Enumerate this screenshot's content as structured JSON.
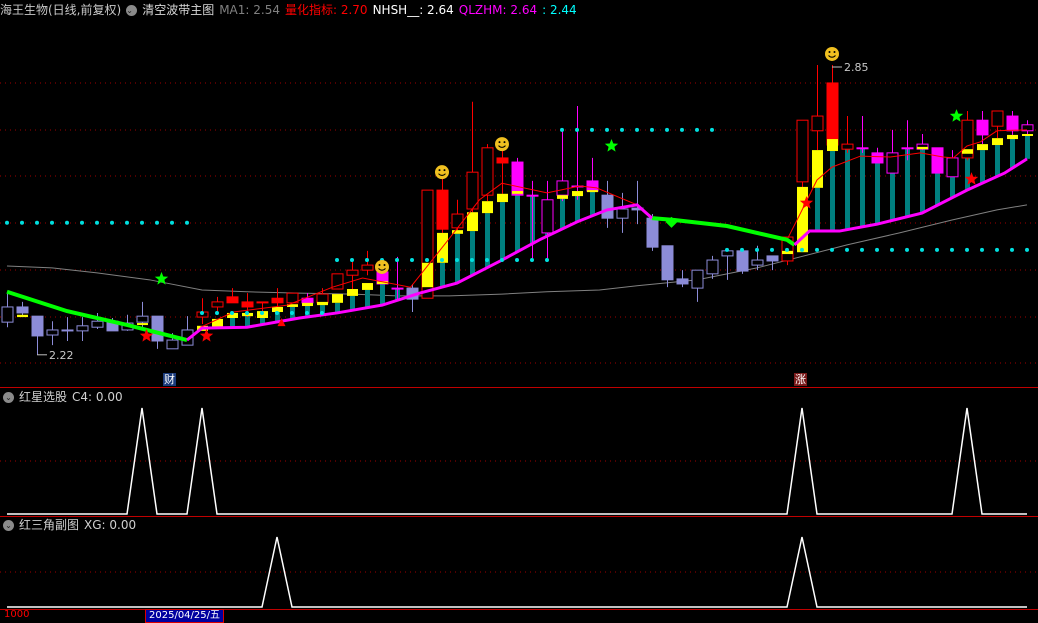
{
  "header": {
    "stock": "海王生物(日线,前复权)",
    "indicator": "清空波带主图",
    "ma1_label": "MA1: 2.54",
    "lh_label": "量化指标: 2.70",
    "nhsh_label": "NHSH__: 2.64",
    "qlzhm_label": "QLZHM: 2.64",
    "qlzhm_val2": ": 2.44"
  },
  "colors": {
    "up": "#ff0000",
    "weak": "#8c8cd8",
    "mag": "#ff00ff",
    "yellow": "#ffff00",
    "teal": "#008080",
    "green": "#00ff00",
    "cyan": "#00e0e0",
    "gray": "#808080",
    "grid": "#a00000"
  },
  "main": {
    "high_label": "2.85",
    "low_label": "2.22",
    "event_tag_1": "财",
    "event_tag_2": "涨",
    "price_range": [
      2.22,
      2.85
    ]
  },
  "chart_data": {
    "type": "candlestick",
    "candles": [
      [
        2.291,
        2.357,
        2.28,
        2.324,
        "L"
      ],
      [
        2.324,
        2.335,
        2.302,
        2.311,
        "L"
      ],
      [
        2.304,
        2.304,
        2.22,
        2.261,
        "L"
      ],
      [
        2.263,
        2.293,
        2.241,
        2.274,
        "L"
      ],
      [
        2.274,
        2.302,
        2.25,
        2.274,
        "L"
      ],
      [
        2.272,
        2.302,
        2.25,
        2.283,
        "L"
      ],
      [
        2.28,
        2.311,
        2.276,
        2.293,
        "L"
      ],
      [
        2.293,
        2.3,
        2.272,
        2.272,
        "L"
      ],
      [
        2.274,
        2.307,
        2.272,
        2.289,
        "L"
      ],
      [
        2.291,
        2.335,
        2.274,
        2.304,
        "L"
      ],
      [
        2.304,
        2.304,
        2.233,
        2.25,
        "L"
      ],
      [
        2.233,
        2.267,
        2.233,
        2.252,
        "L"
      ],
      [
        2.241,
        2.304,
        2.241,
        2.274,
        "L"
      ],
      [
        2.302,
        2.343,
        2.287,
        2.313,
        "R"
      ],
      [
        2.324,
        2.346,
        2.313,
        2.335,
        "R"
      ],
      [
        2.346,
        2.365,
        2.333,
        2.333,
        "R"
      ],
      [
        2.335,
        2.354,
        2.302,
        2.324,
        "R"
      ],
      [
        2.335,
        2.335,
        2.313,
        2.333,
        "R"
      ],
      [
        2.343,
        2.365,
        2.324,
        2.333,
        "R"
      ],
      [
        2.333,
        2.354,
        2.333,
        2.354,
        "R"
      ],
      [
        2.343,
        2.354,
        2.333,
        2.333,
        "M"
      ],
      [
        2.333,
        2.365,
        2.333,
        2.352,
        "R"
      ],
      [
        2.363,
        2.396,
        2.363,
        2.396,
        "R"
      ],
      [
        2.393,
        2.422,
        2.363,
        2.404,
        "R"
      ],
      [
        2.404,
        2.446,
        2.393,
        2.415,
        "R"
      ],
      [
        2.4,
        2.43,
        2.374,
        2.374,
        "M"
      ],
      [
        2.365,
        2.433,
        2.339,
        2.365,
        "M"
      ],
      [
        2.365,
        2.374,
        2.313,
        2.341,
        "L"
      ],
      [
        2.343,
        2.578,
        2.343,
        2.578,
        "R"
      ],
      [
        2.578,
        2.609,
        2.485,
        2.493,
        "R"
      ],
      [
        2.496,
        2.557,
        2.491,
        2.526,
        "R"
      ],
      [
        2.537,
        2.77,
        2.53,
        2.617,
        "R"
      ],
      [
        2.567,
        2.678,
        2.554,
        2.67,
        "R"
      ],
      [
        2.648,
        2.678,
        2.57,
        2.637,
        "R"
      ],
      [
        2.639,
        2.648,
        2.567,
        2.567,
        "M"
      ],
      [
        2.567,
        2.598,
        2.43,
        2.567,
        "M"
      ],
      [
        2.485,
        2.598,
        2.43,
        2.557,
        "M"
      ],
      [
        2.567,
        2.709,
        2.554,
        2.598,
        "M"
      ],
      [
        2.587,
        2.761,
        2.557,
        2.587,
        "M"
      ],
      [
        2.598,
        2.648,
        2.576,
        2.576,
        "M"
      ],
      [
        2.567,
        2.598,
        2.496,
        2.517,
        "L"
      ],
      [
        2.517,
        2.572,
        2.485,
        2.537,
        "L"
      ],
      [
        2.539,
        2.598,
        2.504,
        2.535,
        "L"
      ],
      [
        2.517,
        2.526,
        2.446,
        2.454,
        "L"
      ],
      [
        2.457,
        2.457,
        2.367,
        2.383,
        "L"
      ],
      [
        2.385,
        2.404,
        2.367,
        2.374,
        "L"
      ],
      [
        2.365,
        2.404,
        2.335,
        2.404,
        "L"
      ],
      [
        2.396,
        2.435,
        2.385,
        2.426,
        "L"
      ],
      [
        2.435,
        2.446,
        2.383,
        2.446,
        "L"
      ],
      [
        2.446,
        2.446,
        2.396,
        2.402,
        "L"
      ],
      [
        2.415,
        2.457,
        2.404,
        2.426,
        "L"
      ],
      [
        2.435,
        2.435,
        2.404,
        2.424,
        "L"
      ],
      [
        2.424,
        2.476,
        2.415,
        2.476,
        "R"
      ],
      [
        2.596,
        2.73,
        2.583,
        2.73,
        "R"
      ],
      [
        2.707,
        2.85,
        2.665,
        2.739,
        "R"
      ],
      [
        2.811,
        2.85,
        2.663,
        2.676,
        "R"
      ],
      [
        2.667,
        2.739,
        2.659,
        2.678,
        "R"
      ],
      [
        2.67,
        2.739,
        2.659,
        2.67,
        "M"
      ],
      [
        2.659,
        2.67,
        2.637,
        2.637,
        "M"
      ],
      [
        2.615,
        2.709,
        2.615,
        2.659,
        "M"
      ],
      [
        2.67,
        2.73,
        2.643,
        2.67,
        "M"
      ],
      [
        2.667,
        2.7,
        2.665,
        2.678,
        "M"
      ],
      [
        2.67,
        2.67,
        2.615,
        2.615,
        "M"
      ],
      [
        2.607,
        2.665,
        2.607,
        2.648,
        "M"
      ],
      [
        2.648,
        2.75,
        2.643,
        2.73,
        "R"
      ],
      [
        2.73,
        2.75,
        2.678,
        2.698,
        "M"
      ],
      [
        2.717,
        2.75,
        2.691,
        2.75,
        "R"
      ],
      [
        2.739,
        2.75,
        2.698,
        2.707,
        "M"
      ],
      [
        2.707,
        2.73,
        2.7,
        2.72,
        "M"
      ]
    ],
    "yellow_boxes": [
      [
        1,
        2.307,
        2.302
      ],
      [
        9,
        2.289,
        2.285
      ],
      [
        13,
        2.283,
        2.272
      ],
      [
        14,
        2.298,
        2.28
      ],
      [
        15,
        2.311,
        2.3
      ],
      [
        16,
        2.311,
        2.304
      ],
      [
        17,
        2.315,
        2.3
      ],
      [
        18,
        2.324,
        2.313
      ],
      [
        19,
        2.33,
        2.324
      ],
      [
        20,
        2.333,
        2.326
      ],
      [
        21,
        2.335,
        2.328
      ],
      [
        22,
        2.352,
        2.333
      ],
      [
        23,
        2.363,
        2.348
      ],
      [
        24,
        2.376,
        2.361
      ],
      [
        25,
        2.38,
        2.374
      ],
      [
        28,
        2.42,
        2.367
      ],
      [
        29,
        2.485,
        2.42
      ],
      [
        30,
        2.491,
        2.483
      ],
      [
        31,
        2.53,
        2.489
      ],
      [
        32,
        2.554,
        2.528
      ],
      [
        33,
        2.57,
        2.552
      ],
      [
        34,
        2.576,
        2.57
      ],
      [
        37,
        2.567,
        2.559
      ],
      [
        38,
        2.576,
        2.565
      ],
      [
        39,
        2.578,
        2.574
      ],
      [
        52,
        2.446,
        2.439
      ],
      [
        53,
        2.585,
        2.443
      ],
      [
        54,
        2.665,
        2.583
      ],
      [
        55,
        2.689,
        2.663
      ],
      [
        61,
        2.672,
        2.667
      ],
      [
        64,
        2.667,
        2.657
      ],
      [
        65,
        2.678,
        2.665
      ],
      [
        66,
        2.691,
        2.676
      ],
      [
        67,
        2.698,
        2.689
      ],
      [
        68,
        2.7,
        2.696
      ]
    ],
    "teal_ranges": [
      [
        14,
        39
      ],
      [
        54,
        68
      ]
    ],
    "lines": {
      "support_weak_1": [
        [
          0,
          2.357
        ],
        [
          4,
          2.315
        ],
        [
          8,
          2.285
        ],
        [
          12,
          2.252
        ]
      ],
      "support_1": [
        [
          12,
          2.252
        ],
        [
          13,
          2.278
        ],
        [
          16,
          2.28
        ],
        [
          19.5,
          2.3
        ],
        [
          22,
          2.311
        ],
        [
          25,
          2.328
        ],
        [
          27.5,
          2.354
        ],
        [
          30,
          2.376
        ],
        [
          33,
          2.426
        ],
        [
          35.5,
          2.47
        ],
        [
          38,
          2.509
        ],
        [
          40,
          2.535
        ],
        [
          42,
          2.546
        ],
        [
          43,
          2.517
        ]
      ],
      "support_weak_2": [
        [
          43,
          2.517
        ],
        [
          44.5,
          2.513
        ],
        [
          48,
          2.5
        ],
        [
          52,
          2.47
        ],
        [
          52.5,
          2.459
        ]
      ],
      "support_2": [
        [
          52.5,
          2.459
        ],
        [
          53.5,
          2.489
        ],
        [
          55.5,
          2.489
        ],
        [
          58,
          2.504
        ],
        [
          61,
          2.528
        ],
        [
          64,
          2.578
        ],
        [
          66.5,
          2.615
        ],
        [
          68,
          2.646
        ]
      ],
      "short_ma_1": [
        [
          12.9,
          2.28
        ],
        [
          15.1,
          2.313
        ],
        [
          18.7,
          2.328
        ],
        [
          21.7,
          2.367
        ],
        [
          23.7,
          2.387
        ],
        [
          26.9,
          2.367
        ],
        [
          29.3,
          2.465
        ],
        [
          31.5,
          2.557
        ],
        [
          33,
          2.593
        ],
        [
          36,
          2.572
        ],
        [
          38.2,
          2.587
        ],
        [
          39.3,
          2.583
        ],
        [
          42,
          2.546
        ]
      ],
      "short_ma_2": [
        [
          52,
          2.47
        ],
        [
          52.9,
          2.528
        ],
        [
          54,
          2.6
        ],
        [
          55,
          2.628
        ],
        [
          56.9,
          2.652
        ],
        [
          58.9,
          2.65
        ],
        [
          60.9,
          2.659
        ],
        [
          62.4,
          2.65
        ],
        [
          63.1,
          2.648
        ],
        [
          64,
          2.674
        ],
        [
          64.9,
          2.683
        ],
        [
          66,
          2.707
        ],
        [
          68,
          2.709
        ]
      ],
      "long_ma": [
        [
          0,
          2.413
        ],
        [
          3,
          2.409
        ],
        [
          6,
          2.398
        ],
        [
          9.5,
          2.383
        ],
        [
          13,
          2.361
        ],
        [
          16,
          2.357
        ],
        [
          19.5,
          2.354
        ],
        [
          23,
          2.352
        ],
        [
          26,
          2.348
        ],
        [
          29.5,
          2.348
        ],
        [
          33,
          2.352
        ],
        [
          36,
          2.357
        ],
        [
          39.5,
          2.361
        ],
        [
          42,
          2.37
        ],
        [
          46,
          2.383
        ],
        [
          50,
          2.409
        ],
        [
          52.9,
          2.433
        ],
        [
          56,
          2.459
        ],
        [
          59.5,
          2.485
        ],
        [
          63,
          2.513
        ],
        [
          66,
          2.535
        ],
        [
          68,
          2.546
        ]
      ]
    },
    "dot_rows": [
      [
        2.507,
        0,
        12
      ],
      [
        2.311,
        13,
        21
      ],
      [
        2.426,
        22,
        36
      ],
      [
        2.709,
        37,
        47
      ],
      [
        2.448,
        48,
        68
      ]
    ],
    "green_stars": [
      [
        10.3,
        2.385
      ],
      [
        40.3,
        2.674
      ],
      [
        63.3,
        2.739
      ]
    ],
    "red_stars": [
      [
        9.3,
        2.261
      ],
      [
        13.3,
        2.261
      ],
      [
        53.3,
        2.55
      ],
      [
        64.3,
        2.602
      ]
    ],
    "smileys": [
      [
        25,
        2.411
      ],
      [
        29,
        2.617
      ],
      [
        33,
        2.678
      ],
      [
        55,
        2.874
      ]
    ],
    "diamonds": [
      [
        44.3,
        2.509
      ]
    ],
    "triangles": [
      [
        18.3,
        2.291
      ]
    ],
    "high_index": 55,
    "low_index": 2
  },
  "sub1": {
    "title": "红星选股",
    "value_label": "C4: 0.00",
    "signal_index": [
      9,
      13,
      53,
      64
    ]
  },
  "sub2": {
    "title": "红三角副图",
    "value_label": "XG: 0.00",
    "signal_index": [
      18,
      53
    ]
  },
  "axis": {
    "date_label": "2025/04/25/五",
    "left_label": "1000"
  }
}
